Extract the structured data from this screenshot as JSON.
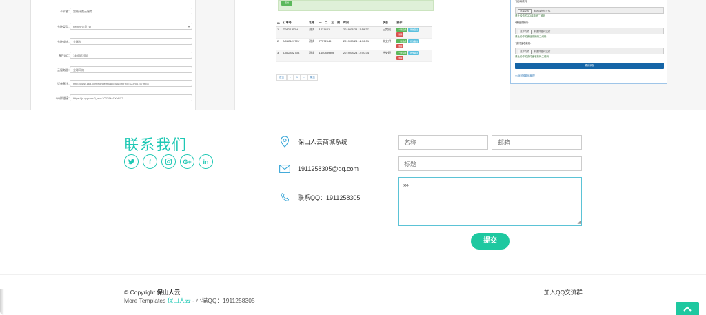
{
  "preview_left": {
    "rows": [
      {
        "label": "卡卡名：",
        "value": "超级计费云服务"
      },
      {
        "label": "卡种类型：",
        "value": "nemed会员 (1)"
      },
      {
        "label": "卡种描述：",
        "value": "全球卡"
      },
      {
        "label": "客户QQ：",
        "value": "1405572555"
      },
      {
        "label": "云服务器：",
        "value": "全球网络"
      },
      {
        "label": "订单备注：",
        "value": "http://www.163.com/songs/music/play.php?id=123/56757.mp3"
      },
      {
        "label": "QQ群链接：",
        "value": "https://jq.qq.com/?_wv=1027&k=5XbBX7"
      }
    ]
  },
  "preview_mid": {
    "banner_button": "查看",
    "headers": [
      "ID",
      "订单号",
      "名称",
      "一",
      "二",
      "三",
      "购",
      "时间",
      "状态",
      "操作"
    ],
    "rows": [
      {
        "id": "1",
        "order": "T0824JB2H",
        "name": "测试",
        "num": "1421421",
        "time": "2019-08-24 11:59:27",
        "status": "已完成",
        "actions": [
          "一键完成",
          "修改备注",
          "删除"
        ]
      },
      {
        "id": "2",
        "order": "N0824JX76V",
        "name": "测试",
        "num": "77572545",
        "time": "2019-08-24 12:36:31",
        "status": "未支付",
        "actions": [
          "一键完成",
          "修改备注",
          "删除"
        ]
      },
      {
        "id": "3",
        "order": "Q0824JZ79A",
        "name": "测试",
        "num": "1450839808",
        "time": "2019-08-24 14:50:34",
        "status": "待处理",
        "actions": [
          "一键完成",
          "修改备注",
          "删除"
        ]
      }
    ],
    "pager": [
      "首页",
      "«",
      "1",
      "»",
      "尾页"
    ]
  },
  "preview_right": {
    "uploads": [
      {
        "label": "*QQ收款码:",
        "choose": "选择文件",
        "file": "未选择任何文件",
        "tip": "请上传你的QQ收款码二维码"
      },
      {
        "label": "*微信收款码:",
        "choose": "选择文件",
        "file": "未选择任何文件",
        "tip": "请上传你的微信收款码二维码"
      },
      {
        "label": "*支付宝收款码:",
        "choose": "选择文件",
        "file": "未选择任何文件",
        "tip": "请上传你的支付宝收款码二维码"
      }
    ],
    "confirm": "确认添加",
    "back": "<<返回收款码管理"
  },
  "contact": {
    "title": "联系我们",
    "socials": [
      {
        "icon": "twitter-icon"
      },
      {
        "icon": "facebook-icon",
        "glyph": "f"
      },
      {
        "icon": "instagram-icon"
      },
      {
        "icon": "google-plus-icon",
        "glyph": "G+"
      },
      {
        "icon": "linkedin-icon",
        "glyph": "in"
      }
    ],
    "address": "保山人云商城系统",
    "email": "1911258305@qq.com",
    "qq": "联系QQ：1911258305",
    "form": {
      "name_placeholder": "名称",
      "email_placeholder": "邮箱",
      "subject_placeholder": "标题",
      "message_value": "›››",
      "submit": "提交"
    },
    "accent": "#1ec8b4"
  },
  "footer": {
    "copyright_prefix": "© Copyright",
    "copyright_brand": "保山人云",
    "more_prefix": "More Templates",
    "more_brand": "保山人云",
    "more_suffix": "- 小猫QQ：1911258305",
    "qq_group": "加入QQ交流群"
  }
}
